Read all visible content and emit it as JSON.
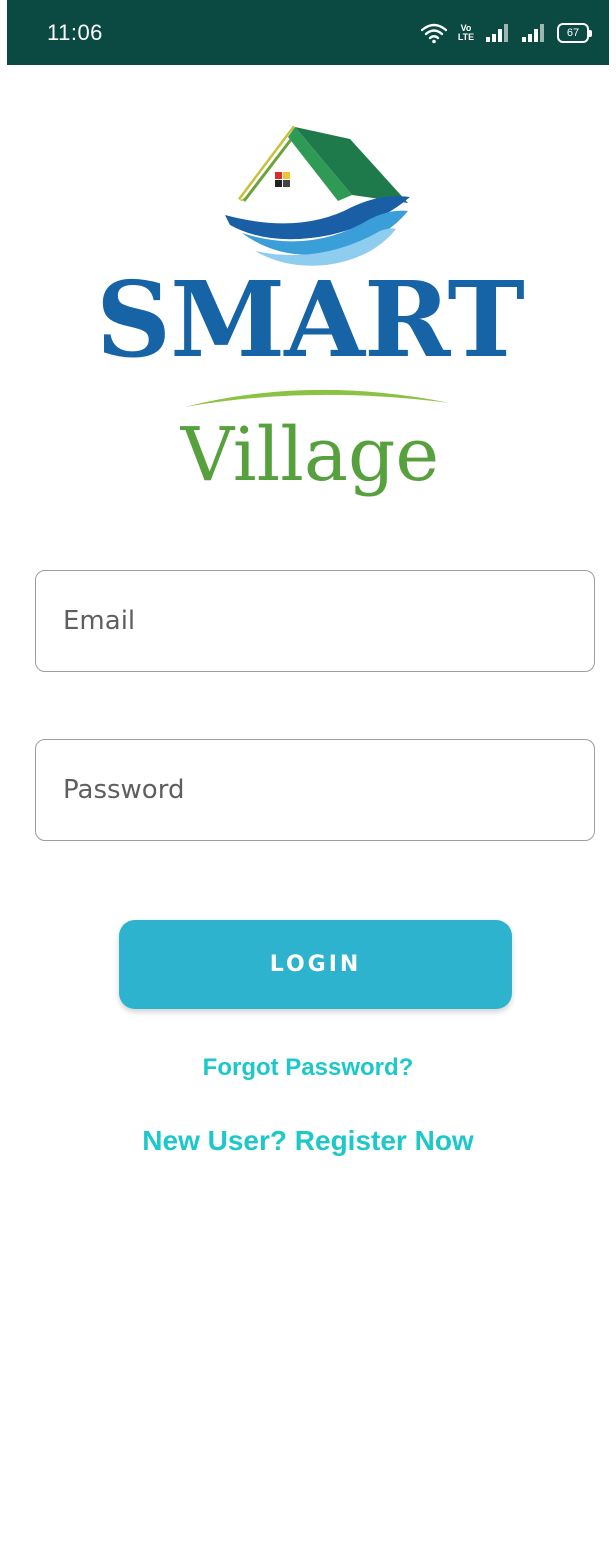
{
  "status_bar": {
    "time": "11:06",
    "volte_top": "Vo",
    "volte_bottom": "LTE",
    "battery": "67"
  },
  "logo": {
    "word_main": "SMART",
    "word_sub": "Village"
  },
  "form": {
    "email_placeholder": "Email",
    "password_placeholder": "Password",
    "login_label": "LOGIN",
    "forgot_label": "Forgot Password?",
    "register_label": "New User? Register Now"
  },
  "colors": {
    "status_bar": "#0b4a43",
    "button": "#2db3cd",
    "link": "#1ec8c8",
    "logo_blue": "#1663a6",
    "logo_green": "#57a03e"
  },
  "icons": [
    "wifi-icon",
    "volte-icon",
    "signal-icon",
    "battery-icon",
    "house-icon"
  ]
}
